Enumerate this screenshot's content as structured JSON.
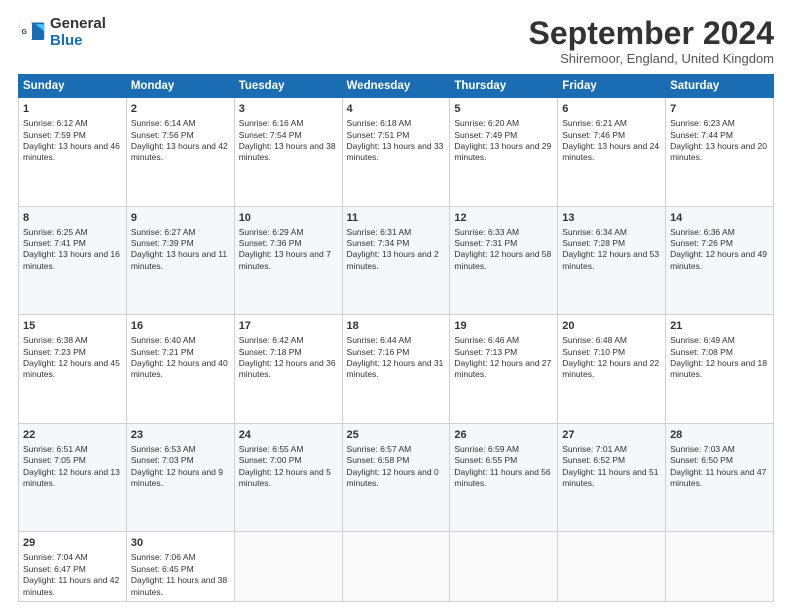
{
  "logo": {
    "general": "General",
    "blue": "Blue"
  },
  "title": "September 2024",
  "location": "Shiremoor, England, United Kingdom",
  "headers": [
    "Sunday",
    "Monday",
    "Tuesday",
    "Wednesday",
    "Thursday",
    "Friday",
    "Saturday"
  ],
  "weeks": [
    [
      {
        "num": "1",
        "sunrise": "6:12 AM",
        "sunset": "7:59 PM",
        "daylight": "13 hours and 46 minutes."
      },
      {
        "num": "2",
        "sunrise": "6:14 AM",
        "sunset": "7:56 PM",
        "daylight": "13 hours and 42 minutes."
      },
      {
        "num": "3",
        "sunrise": "6:16 AM",
        "sunset": "7:54 PM",
        "daylight": "13 hours and 38 minutes."
      },
      {
        "num": "4",
        "sunrise": "6:18 AM",
        "sunset": "7:51 PM",
        "daylight": "13 hours and 33 minutes."
      },
      {
        "num": "5",
        "sunrise": "6:20 AM",
        "sunset": "7:49 PM",
        "daylight": "13 hours and 29 minutes."
      },
      {
        "num": "6",
        "sunrise": "6:21 AM",
        "sunset": "7:46 PM",
        "daylight": "13 hours and 24 minutes."
      },
      {
        "num": "7",
        "sunrise": "6:23 AM",
        "sunset": "7:44 PM",
        "daylight": "13 hours and 20 minutes."
      }
    ],
    [
      {
        "num": "8",
        "sunrise": "6:25 AM",
        "sunset": "7:41 PM",
        "daylight": "13 hours and 16 minutes."
      },
      {
        "num": "9",
        "sunrise": "6:27 AM",
        "sunset": "7:39 PM",
        "daylight": "13 hours and 11 minutes."
      },
      {
        "num": "10",
        "sunrise": "6:29 AM",
        "sunset": "7:36 PM",
        "daylight": "13 hours and 7 minutes."
      },
      {
        "num": "11",
        "sunrise": "6:31 AM",
        "sunset": "7:34 PM",
        "daylight": "13 hours and 2 minutes."
      },
      {
        "num": "12",
        "sunrise": "6:33 AM",
        "sunset": "7:31 PM",
        "daylight": "12 hours and 58 minutes."
      },
      {
        "num": "13",
        "sunrise": "6:34 AM",
        "sunset": "7:28 PM",
        "daylight": "12 hours and 53 minutes."
      },
      {
        "num": "14",
        "sunrise": "6:36 AM",
        "sunset": "7:26 PM",
        "daylight": "12 hours and 49 minutes."
      }
    ],
    [
      {
        "num": "15",
        "sunrise": "6:38 AM",
        "sunset": "7:23 PM",
        "daylight": "12 hours and 45 minutes."
      },
      {
        "num": "16",
        "sunrise": "6:40 AM",
        "sunset": "7:21 PM",
        "daylight": "12 hours and 40 minutes."
      },
      {
        "num": "17",
        "sunrise": "6:42 AM",
        "sunset": "7:18 PM",
        "daylight": "12 hours and 36 minutes."
      },
      {
        "num": "18",
        "sunrise": "6:44 AM",
        "sunset": "7:16 PM",
        "daylight": "12 hours and 31 minutes."
      },
      {
        "num": "19",
        "sunrise": "6:46 AM",
        "sunset": "7:13 PM",
        "daylight": "12 hours and 27 minutes."
      },
      {
        "num": "20",
        "sunrise": "6:48 AM",
        "sunset": "7:10 PM",
        "daylight": "12 hours and 22 minutes."
      },
      {
        "num": "21",
        "sunrise": "6:49 AM",
        "sunset": "7:08 PM",
        "daylight": "12 hours and 18 minutes."
      }
    ],
    [
      {
        "num": "22",
        "sunrise": "6:51 AM",
        "sunset": "7:05 PM",
        "daylight": "12 hours and 13 minutes."
      },
      {
        "num": "23",
        "sunrise": "6:53 AM",
        "sunset": "7:03 PM",
        "daylight": "12 hours and 9 minutes."
      },
      {
        "num": "24",
        "sunrise": "6:55 AM",
        "sunset": "7:00 PM",
        "daylight": "12 hours and 5 minutes."
      },
      {
        "num": "25",
        "sunrise": "6:57 AM",
        "sunset": "6:58 PM",
        "daylight": "12 hours and 0 minutes."
      },
      {
        "num": "26",
        "sunrise": "6:59 AM",
        "sunset": "6:55 PM",
        "daylight": "11 hours and 56 minutes."
      },
      {
        "num": "27",
        "sunrise": "7:01 AM",
        "sunset": "6:52 PM",
        "daylight": "11 hours and 51 minutes."
      },
      {
        "num": "28",
        "sunrise": "7:03 AM",
        "sunset": "6:50 PM",
        "daylight": "11 hours and 47 minutes."
      }
    ],
    [
      {
        "num": "29",
        "sunrise": "7:04 AM",
        "sunset": "6:47 PM",
        "daylight": "11 hours and 42 minutes."
      },
      {
        "num": "30",
        "sunrise": "7:06 AM",
        "sunset": "6:45 PM",
        "daylight": "11 hours and 38 minutes."
      },
      null,
      null,
      null,
      null,
      null
    ]
  ],
  "labels": {
    "sunrise": "Sunrise:",
    "sunset": "Sunset:",
    "daylight": "Daylight:"
  }
}
